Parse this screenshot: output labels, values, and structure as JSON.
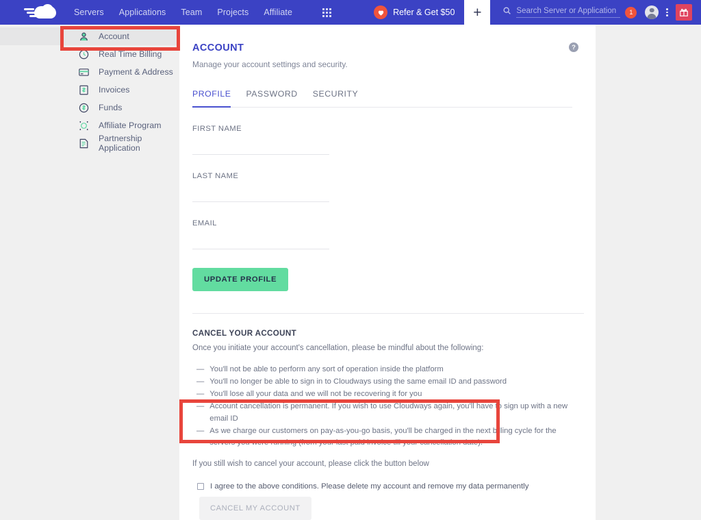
{
  "topbar": {
    "logo_name": "cloudways-logo",
    "nav": [
      {
        "label": "Servers"
      },
      {
        "label": "Applications"
      },
      {
        "label": "Team"
      },
      {
        "label": "Projects"
      },
      {
        "label": "Affiliate"
      }
    ],
    "grid_icon": "apps-grid-icon",
    "refer_label": "Refer & Get $50",
    "plus_label": "+",
    "search": {
      "placeholder": "Search Server or Application",
      "value": "",
      "icon": "search-icon"
    },
    "notification_count": "1",
    "avatar_icon": "user-avatar-icon",
    "kebab_icon": "more-vertical-icon",
    "gift_icon": "gift-icon"
  },
  "sidebar": {
    "items": [
      {
        "label": "Account",
        "icon": "user-icon",
        "active": true
      },
      {
        "label": "Real Time Billing",
        "icon": "clock-icon",
        "active": false
      },
      {
        "label": "Payment & Address",
        "icon": "credit-card-icon",
        "active": false
      },
      {
        "label": "Invoices",
        "icon": "invoice-icon",
        "active": false
      },
      {
        "label": "Funds",
        "icon": "funds-icon",
        "active": false
      },
      {
        "label": "Affiliate Program",
        "icon": "affiliate-icon",
        "active": false
      },
      {
        "label": "Partnership Application",
        "icon": "partnership-icon",
        "active": false
      }
    ]
  },
  "main": {
    "title": "ACCOUNT",
    "subtitle": "Manage your account settings and security.",
    "help_icon": "help-circle-icon",
    "help_glyph": "?",
    "tabs": [
      {
        "label": "PROFILE",
        "active": true
      },
      {
        "label": "PASSWORD",
        "active": false
      },
      {
        "label": "SECURITY",
        "active": false
      }
    ],
    "profile": {
      "fields": [
        {
          "label": "FIRST NAME",
          "value": "",
          "placeholder": ""
        },
        {
          "label": "LAST NAME",
          "value": "",
          "placeholder": ""
        },
        {
          "label": "EMAIL",
          "value": "",
          "placeholder": ""
        }
      ],
      "update_button": "UPDATE PROFILE"
    },
    "cancel": {
      "title": "CANCEL YOUR ACCOUNT",
      "intro": "Once you initiate your account's cancellation, please be mindful about the following:",
      "dash": "—",
      "bullets": [
        "You'll not be able to perform any sort of operation inside the platform",
        "You'll no longer be able to sign in to Cloudways using the same email ID and password",
        "You'll lose all your data and we will not be recovering it for you",
        "Account cancellation is permanent. If you wish to use Cloudways again, you'll have to sign up with a new email ID",
        "As we charge our customers on pay-as-you-go basis, you'll be charged in the next billing cycle for the servers you were running (from your last paid invoice till your cancellation date)."
      ],
      "footer": "If you still wish to cancel your account, please click the button below",
      "agree_label": "I agree to the above conditions. Please delete my account and remove my data permanently",
      "agree_checked": false,
      "cancel_button": "CANCEL MY ACCOUNT"
    }
  },
  "annotations": {
    "accent_color": "#e8453c",
    "boxes": [
      {
        "name": "highlight-sidebar-account"
      },
      {
        "name": "highlight-cancel-account-controls"
      }
    ]
  },
  "colors": {
    "brand_blue": "#3b42c4",
    "accent_green": "#62dca0",
    "badge_orange": "#f0543c",
    "gift_red": "#e0445f",
    "annotation_red": "#e8453c",
    "tab_active": "#4950cf"
  }
}
